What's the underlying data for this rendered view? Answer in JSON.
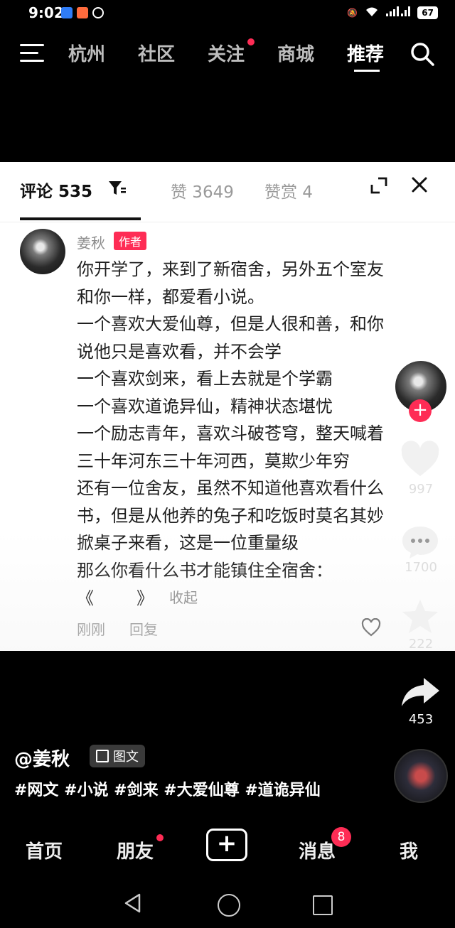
{
  "status_bar": {
    "time": "9:02",
    "battery": "67"
  },
  "top_nav": {
    "tabs": [
      {
        "label": "杭州"
      },
      {
        "label": "社区"
      },
      {
        "label": "关注"
      },
      {
        "label": "商城"
      },
      {
        "label": "推荐"
      }
    ],
    "active_tab": "推荐"
  },
  "comment_panel": {
    "tabs": {
      "comments": "评论 535",
      "likes": "赞 3649",
      "rewards": "赞赏 4"
    },
    "comment": {
      "author": "姜秋",
      "badge": "作者",
      "lines": [
        "你开学了，来到了新宿舍，另外五个室友",
        "和你一样，都爱看小说。",
        "一个喜欢大爱仙尊，但是人很和善，和你",
        "说他只是喜欢看，并不会学",
        "一个喜欢剑来，看上去就是个学霸",
        "一个喜欢道诡异仙，精神状态堪忧",
        "一个励志青年，喜欢斗破苍穹，整天喊着",
        "三十年河东三十年河西，莫欺少年穷",
        "还有一位舍友，虽然不知道他喜欢看什么",
        "书，但是从他养的兔子和吃饭时莫名其妙",
        "掀桌子来看，这是一位重量级",
        "那么你看什么书才能镇住全宿舍："
      ],
      "quote_open": "《",
      "quote_close": "》",
      "collapse": "收起",
      "time": "刚刚",
      "reply": "回复"
    }
  },
  "side_rail": {
    "like_count": "997",
    "comment_count": "1700",
    "favorite_count": "222",
    "share_count": "453"
  },
  "post": {
    "author": "@姜秋",
    "type_label": "图文",
    "hashtags": "#网文 #小说 #剑来 #大爱仙尊 #道诡异仙"
  },
  "bottom_nav": {
    "home": "首页",
    "friends": "朋友",
    "messages": "消息",
    "messages_badge": "8",
    "me": "我"
  },
  "colors": {
    "accent": "#fe2c55",
    "background": "#000000",
    "panel": "#ffffff"
  }
}
